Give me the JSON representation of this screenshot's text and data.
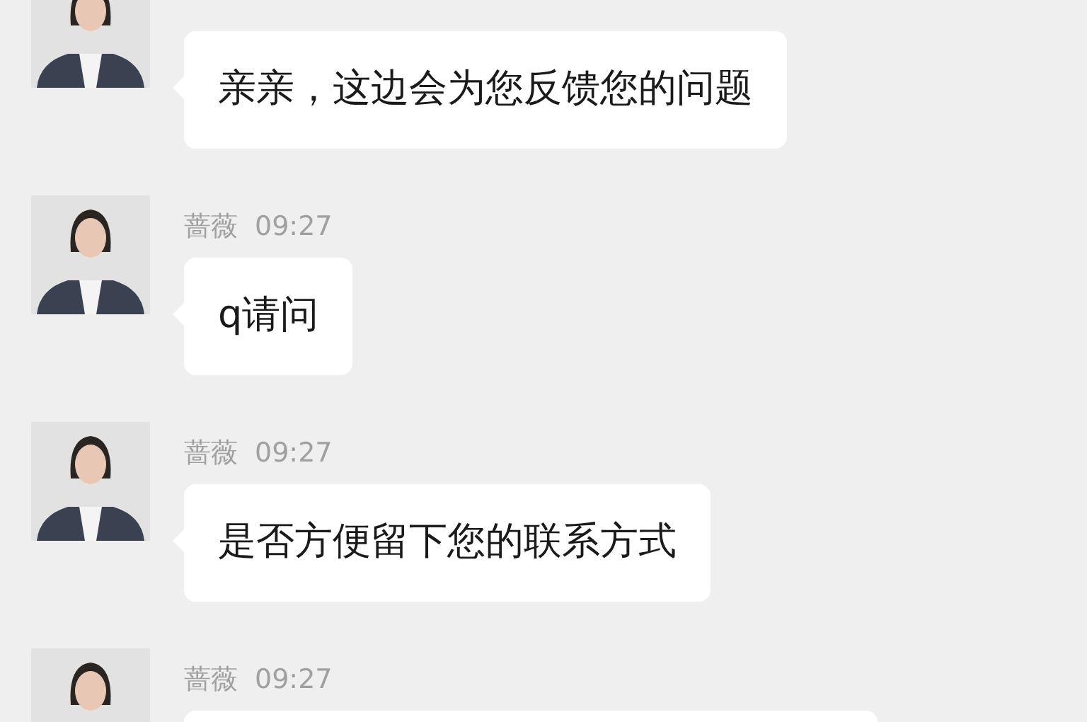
{
  "messages": [
    {
      "text": "亲亲，这边会为您反馈您的问题"
    },
    {
      "name": "蔷薇",
      "time": "09:27",
      "text": "q请问"
    },
    {
      "name": "蔷薇",
      "time": "09:27",
      "text": "是否方便留下您的联系方式"
    },
    {
      "name": "蔷薇",
      "time": "09:27"
    }
  ]
}
